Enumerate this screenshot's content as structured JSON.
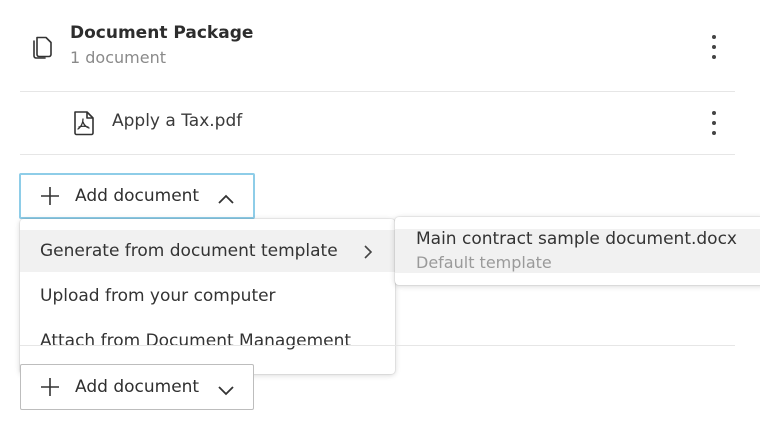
{
  "package": {
    "title": "Document Package",
    "subtitle": "1 document",
    "icon": "copy-documents-icon",
    "more_icon": "kebab-menu-icon"
  },
  "documents": [
    {
      "name": "Apply a Tax.pdf",
      "icon": "pdf-file-icon",
      "more_icon": "kebab-menu-icon"
    }
  ],
  "add_button_open": {
    "label": "Add document",
    "icon": "plus-icon",
    "chevron": "chevron-up-icon"
  },
  "add_menu": {
    "items": [
      {
        "label": "Generate from document template",
        "has_submenu": true
      },
      {
        "label": "Upload from your computer"
      },
      {
        "label": "Attach from Document Management"
      }
    ]
  },
  "template_submenu": {
    "items": [
      {
        "title": "Main contract sample document.docx",
        "caption": "Default template"
      }
    ]
  },
  "add_button_closed": {
    "label": "Add document",
    "icon": "plus-icon",
    "chevron": "chevron-down-icon"
  },
  "colors": {
    "focus_border": "#8ecde8",
    "hover_bg": "#f1f1f1",
    "muted_text": "#8a8a8a"
  }
}
